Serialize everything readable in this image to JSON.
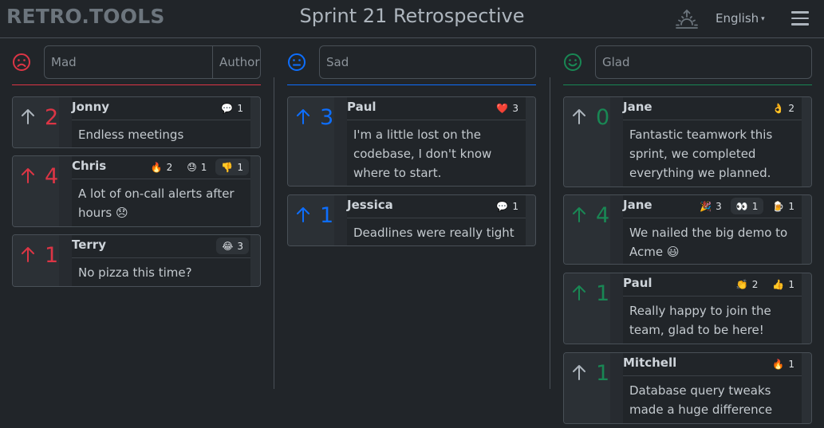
{
  "header": {
    "brand": "RETRO.TOOLS",
    "title": "Sprint 21 Retrospective",
    "language": "English",
    "language_caret": "▾",
    "icons": {
      "reveal": "sunrise-icon",
      "menu": "hamburger-menu-icon"
    }
  },
  "colors": {
    "mad": "#dc3545",
    "sad": "#0d6efd",
    "glad": "#198754",
    "neutral_arrow": "#adb5bd"
  },
  "columns": [
    {
      "key": "mad",
      "icon": "frown-face-icon",
      "placeholder": "Mad",
      "author_placeholder": "Author",
      "cards": [
        {
          "author": "Jonny",
          "votes": "2",
          "voted": false,
          "text": "Endless meetings",
          "reactions": [
            {
              "emoji": "💬",
              "name": "speech-bubble",
              "count": "1",
              "active": false
            }
          ]
        },
        {
          "author": "Chris",
          "votes": "4",
          "voted": true,
          "text": "A lot of on-call alerts after hours 😞",
          "reactions": [
            {
              "emoji": "🔥",
              "name": "fire",
              "count": "2",
              "active": false
            },
            {
              "emoji": "😓",
              "name": "sweat",
              "count": "1",
              "active": false
            },
            {
              "emoji": "👎",
              "name": "thumbs-down",
              "count": "1",
              "active": true
            }
          ]
        },
        {
          "author": "Terry",
          "votes": "1",
          "voted": true,
          "text": "No pizza this time?",
          "reactions": [
            {
              "emoji": "😂",
              "name": "tears-of-joy",
              "count": "3",
              "active": true
            }
          ]
        }
      ]
    },
    {
      "key": "sad",
      "icon": "neutral-face-icon",
      "placeholder": "Sad",
      "cards": [
        {
          "author": "Paul",
          "votes": "3",
          "voted": true,
          "text": "I'm a little lost on the codebase, I don't know where to start.",
          "reactions": [
            {
              "emoji": "❤️",
              "name": "heart",
              "count": "3",
              "active": false
            }
          ]
        },
        {
          "author": "Jessica",
          "votes": "1",
          "voted": true,
          "text": "Deadlines were really tight",
          "reactions": [
            {
              "emoji": "💬",
              "name": "speech-bubble",
              "count": "1",
              "active": false
            }
          ]
        }
      ]
    },
    {
      "key": "glad",
      "icon": "smile-face-icon",
      "placeholder": "Glad",
      "cards": [
        {
          "author": "Jane",
          "votes": "0",
          "voted": false,
          "text": "Fantastic teamwork this sprint, we completed everything we planned.",
          "reactions": [
            {
              "emoji": "👌",
              "name": "ok-hand",
              "count": "2",
              "active": false
            }
          ]
        },
        {
          "author": "Jane",
          "votes": "4",
          "voted": true,
          "text": "We nailed the big demo to Acme 😃",
          "reactions": [
            {
              "emoji": "🎉",
              "name": "party-popper",
              "count": "3",
              "active": false
            },
            {
              "emoji": "👀",
              "name": "eyes",
              "count": "1",
              "active": true
            },
            {
              "emoji": "🍺",
              "name": "beer",
              "count": "1",
              "active": false
            }
          ]
        },
        {
          "author": "Paul",
          "votes": "1",
          "voted": true,
          "text": "Really happy to join the team, glad to be here!",
          "reactions": [
            {
              "emoji": "👏",
              "name": "clap",
              "count": "2",
              "active": false
            },
            {
              "emoji": "👍",
              "name": "thumbs-up",
              "count": "1",
              "active": false
            }
          ]
        },
        {
          "author": "Mitchell",
          "votes": "1",
          "voted": false,
          "text": "Database query tweaks made a huge difference",
          "reactions": [
            {
              "emoji": "🔥",
              "name": "fire",
              "count": "1",
              "active": false
            }
          ]
        }
      ]
    }
  ]
}
